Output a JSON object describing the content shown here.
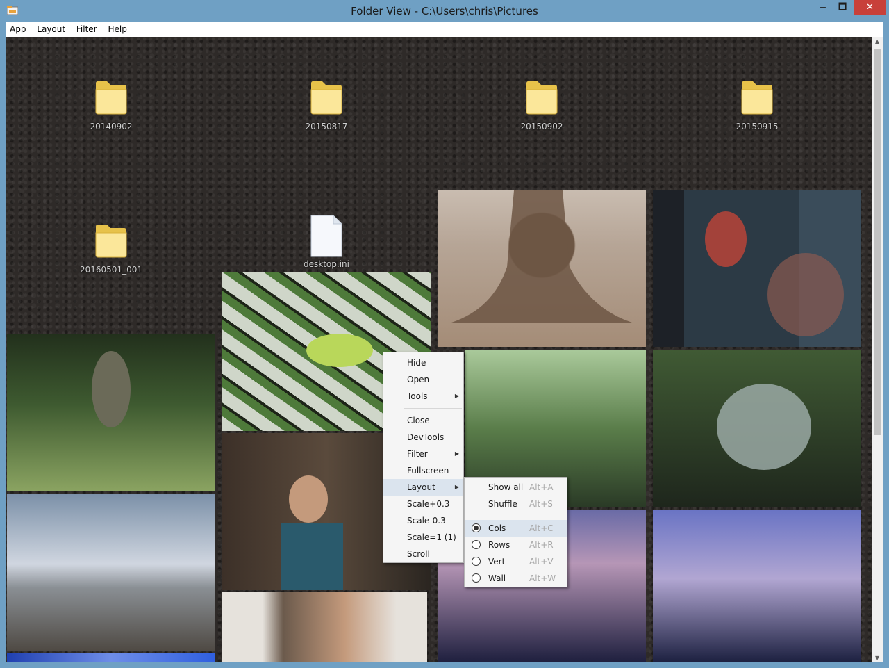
{
  "window": {
    "title": "Folder View - C:\\Users\\chris\\Pictures",
    "minimize_glyph": "🗕",
    "maximize_glyph": "🗖",
    "close_glyph": "✕"
  },
  "menubar": {
    "items": [
      "App",
      "Layout",
      "Filter",
      "Help"
    ]
  },
  "folders": [
    {
      "name": "20140902"
    },
    {
      "name": "20150817"
    },
    {
      "name": "20150902"
    },
    {
      "name": "20150915"
    },
    {
      "name": "20160501_001"
    }
  ],
  "files": [
    {
      "name": "desktop.ini"
    }
  ],
  "photos": [
    {
      "subject": "tree-roots-photo",
      "colors": [
        "#a48c77",
        "#6d5644",
        "#c9bcb0"
      ]
    },
    {
      "subject": "aquarium-octopus-photo",
      "colors": [
        "#2c3a45",
        "#a3423a",
        "#1d2127"
      ]
    },
    {
      "subject": "frog-on-leaf-photo",
      "colors": [
        "#cfd6c9",
        "#4e7a3a",
        "#1d2418"
      ]
    },
    {
      "subject": "toad-in-water-photo",
      "colors": [
        "#3e5a30",
        "#8aa361",
        "#22301c"
      ]
    },
    {
      "subject": "aquarium-plants-photo",
      "colors": [
        "#5a7d4a",
        "#a9c99a",
        "#2a3a26"
      ]
    },
    {
      "subject": "acrylic-dome-tank-photo",
      "colors": [
        "#405a34",
        "#9aa9a4",
        "#1e261c"
      ]
    },
    {
      "subject": "museum-visitor-photo",
      "colors": [
        "#3c3028",
        "#2a5a6c",
        "#8a6a52"
      ]
    },
    {
      "subject": "mountain-river-town-photo",
      "colors": [
        "#7b90a8",
        "#d0d6e0",
        "#4f4a44"
      ]
    },
    {
      "subject": "dusk-pier-photo",
      "colors": [
        "#6a6ba6",
        "#b696b6",
        "#1e1f3e"
      ]
    },
    {
      "subject": "dusk-river-photo",
      "colors": [
        "#6a74c4",
        "#b1a6d2",
        "#1c2040"
      ]
    },
    {
      "subject": "smiling-person-photo",
      "colors": [
        "#6b5a4c",
        "#c49a7c",
        "#e6e2dc"
      ]
    },
    {
      "subject": "blue-sky-photo",
      "colors": [
        "#2f5fe0",
        "#6e8de8",
        "#2040b0"
      ]
    }
  ],
  "context_menu": {
    "items": [
      {
        "label": "Hide"
      },
      {
        "label": "Open"
      },
      {
        "label": "Tools",
        "arrow": "▶"
      },
      {
        "label": "Close"
      },
      {
        "label": "DevTools"
      },
      {
        "label": "Filter",
        "arrow": "▶"
      },
      {
        "label": "Fullscreen"
      },
      {
        "label": "Layout",
        "arrow": "▶",
        "highlighted": true
      },
      {
        "label": "Scale+0.3"
      },
      {
        "label": "Scale-0.3"
      },
      {
        "label": "Scale=1 (1)"
      },
      {
        "label": "Scroll"
      }
    ]
  },
  "layout_submenu": {
    "actions": [
      {
        "label": "Show all",
        "accel": "Alt+A"
      },
      {
        "label": "Shuffle",
        "accel": "Alt+S"
      }
    ],
    "modes": [
      {
        "label": "Cols",
        "accel": "Alt+C",
        "selected": true
      },
      {
        "label": "Rows",
        "accel": "Alt+R",
        "selected": false
      },
      {
        "label": "Vert",
        "accel": "Alt+V",
        "selected": false
      },
      {
        "label": "Wall",
        "accel": "Alt+W",
        "selected": false
      }
    ]
  },
  "scrollbar": {
    "up_glyph": "▲",
    "down_glyph": "▼"
  }
}
